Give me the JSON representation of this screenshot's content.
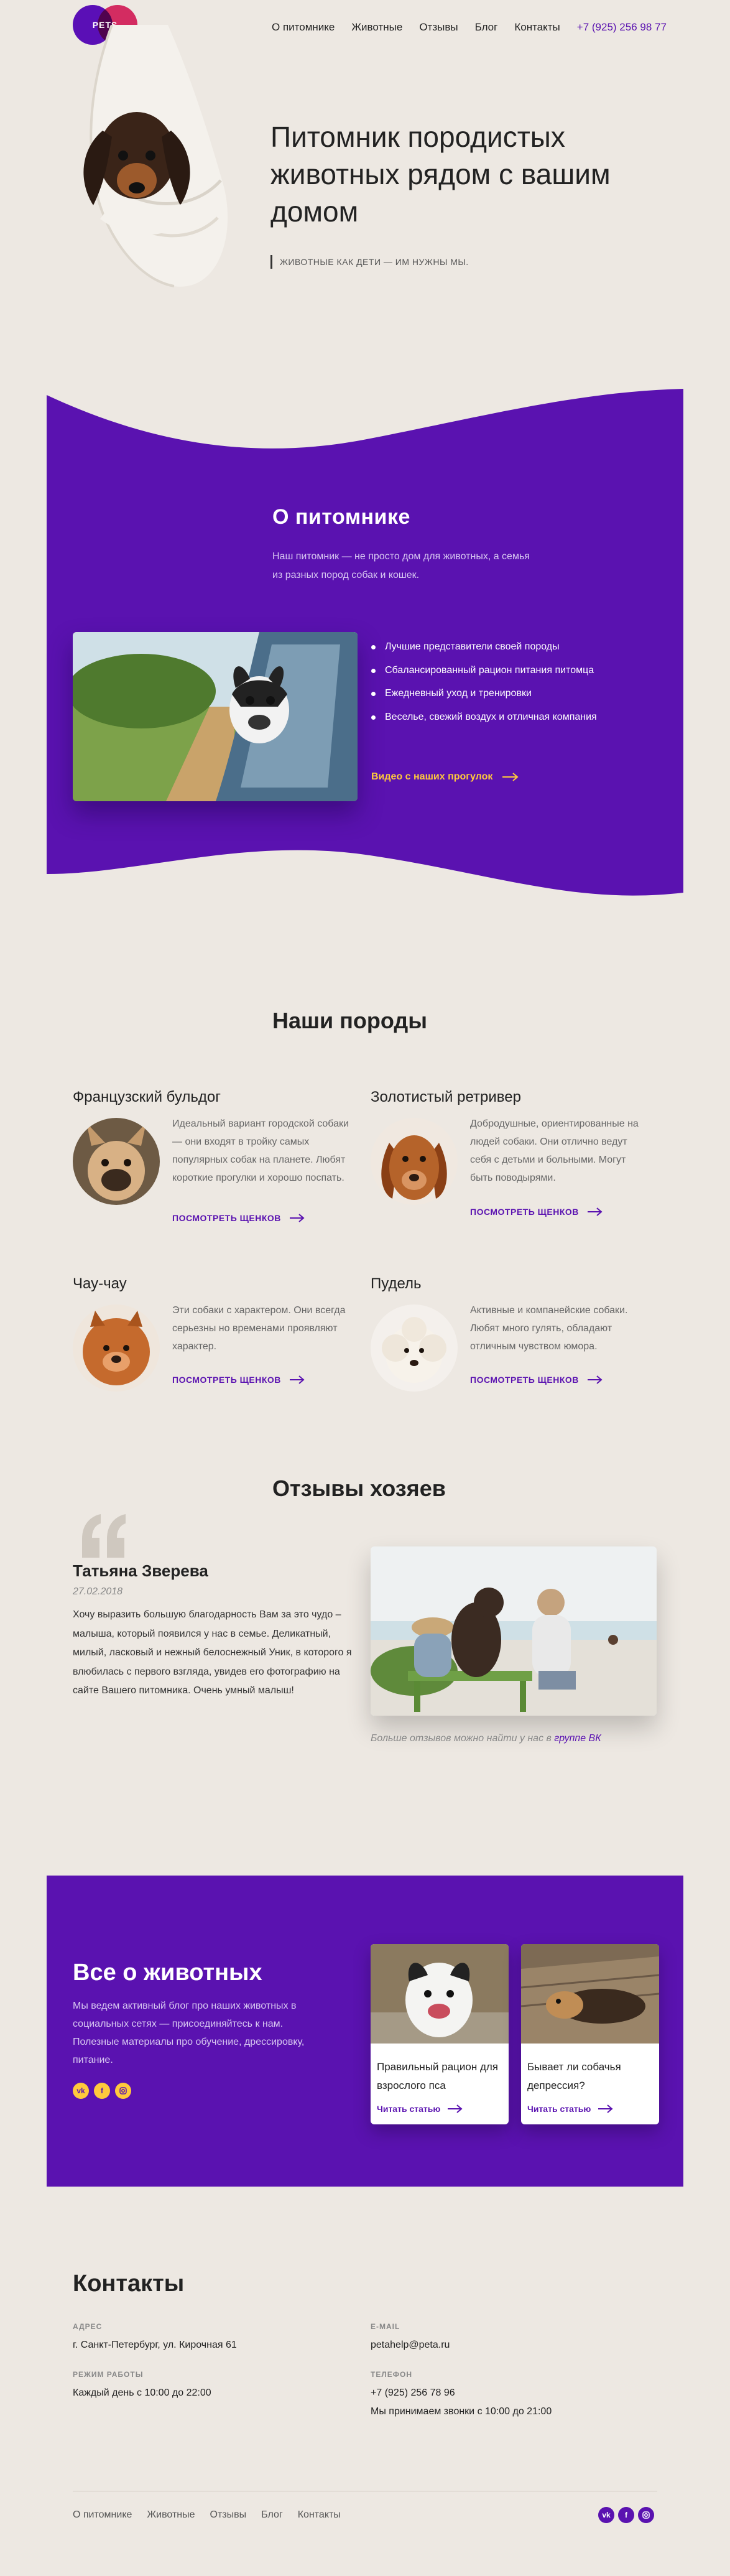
{
  "header": {
    "logo": "PETS",
    "nav": [
      "О питомнике",
      "Животные",
      "Отзывы",
      "Блог",
      "Контакты"
    ],
    "phone": "+7 (925) 256 98 77"
  },
  "hero": {
    "title": "Питомник породистых животных рядом с вашим домом",
    "subtitle": "ЖИВОТНЫЕ КАК ДЕТИ — ИМ НУЖНЫ МЫ."
  },
  "about": {
    "title": "О питомнике",
    "description": "Наш питомник — не просто дом для животных, а семья из разных пород собак и кошек.",
    "features": [
      "Лучшие представители своей породы",
      "Сбалансированный рацион питания питомца",
      "Ежедневный уход и тренировки",
      "Веселье, свежий воздух и отличная компания"
    ],
    "video_link": "Видео с наших прогулок"
  },
  "breeds": {
    "title": "Наши породы",
    "link_label": "ПОСМОТРЕТЬ ЩЕНКОВ",
    "items": [
      {
        "name": "Французский бульдог",
        "desc": "Идеальный вариант городской собаки — они входят в тройку самых популярных собак на планете. Любят короткие прогулки и хорошо поспать."
      },
      {
        "name": "Золотистый ретривер",
        "desc": "Добродушные, ориентированные на людей собаки. Они отлично ведут себя с детьми и больными. Могут быть поводырями."
      },
      {
        "name": "Чау-чау",
        "desc": "Эти собаки с характером. Они всегда серьезны но временами проявляют характер."
      },
      {
        "name": "Пудель",
        "desc": "Активные и компанейские собаки. Любят много гулять, обладают отличным чувством юмора."
      }
    ]
  },
  "reviews": {
    "title": "Отзывы хозяев",
    "name": "Татьяна Зверева",
    "date": "27.02.2018",
    "text": "Хочу выразить большую благодарность Вам за это чудо – малыша, который появился у нас в семье. Деликатный, милый, ласковый и нежный белоснежный Уник, в которого я влюбилась с первого взгляда, увидев его фотографию на сайте Вашего питомника. Очень умный малыш!",
    "more_text": "Больше отзывов можно найти у нас в",
    "more_link": "группе ВК"
  },
  "blog": {
    "title": "Все о животных",
    "description": "Мы ведем активный блог про наших животных в социальных сетях — присоединяйтесь к нам. Полезные материалы про обучение, дрессировку, питание.",
    "social": [
      "vk",
      "f",
      "ig"
    ],
    "read_label": "Читать статью",
    "cards": [
      {
        "title": "Правильный рацион для взрослого пса"
      },
      {
        "title": "Бывает ли собачья депрессия?"
      }
    ]
  },
  "contacts": {
    "title": "Контакты",
    "address_label": "Адрес",
    "address": "г. Санкт-Петербург, ул. Кирочная 61",
    "hours_label": "Режим работы",
    "hours": "Каждый день с 10:00 до 22:00",
    "email_label": "E-mail",
    "email": "petahelp@peta.ru",
    "phone_label": "Телефон",
    "phone": "+7 (925) 256 78 96",
    "phone_note": "Мы принимаем звонки с 10:00 до 21:00"
  },
  "footer": {
    "nav": [
      "О питомнике",
      "Животные",
      "Отзывы",
      "Блог",
      "Контакты"
    ],
    "social": [
      "vk",
      "f",
      "ig"
    ]
  },
  "colors": {
    "accent": "#5a12b0",
    "accent_alt": "#e3306d",
    "highlight": "#ffc93c",
    "background": "#ede8e2"
  }
}
